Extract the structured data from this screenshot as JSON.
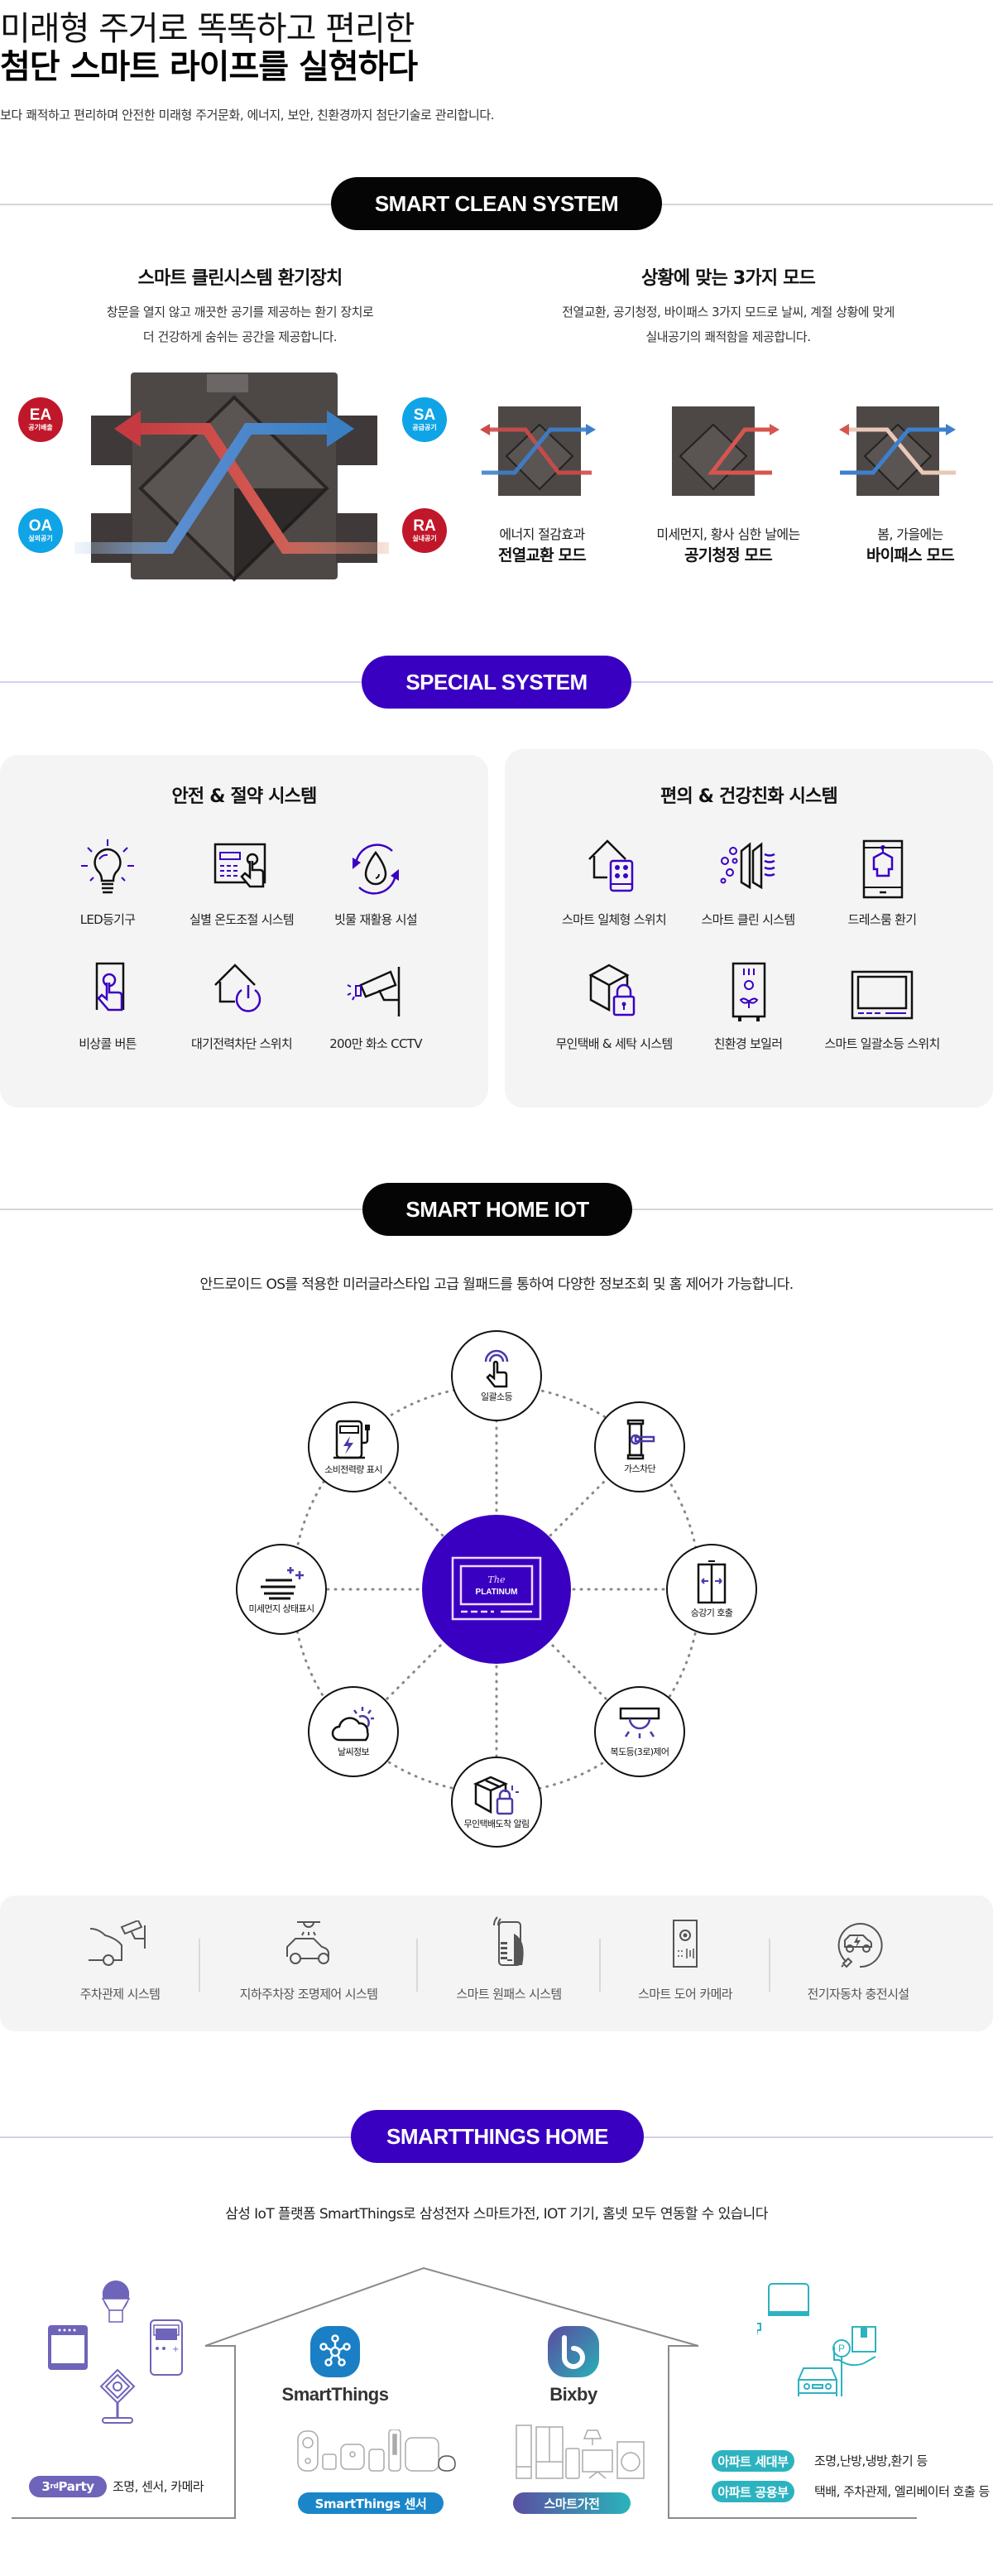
{
  "hero": {
    "line1": "미래형 주거로 똑똑하고 편리한",
    "line2": "첨단 스마트 라이프를 실현하다",
    "description": "보다 쾌적하고 편리하며 안전한 미래형 주거문화, 에너지, 보안, 친환경까지 첨단기술로 관리합니다."
  },
  "colors": {
    "accent_purple": "#3a00c2",
    "black_pill": "#050505",
    "ea_red": "#c0172b",
    "oa_blue": "#0fa4e6",
    "panel_bg": "#f4f4f5",
    "smartthings_blue": "#1a86c9",
    "teal": "#2db3c0",
    "third_party_purple": "#6e64b9"
  },
  "smart_clean": {
    "section_label": "SMART CLEAN SYSTEM",
    "left": {
      "title": "스마트 클린시스템 환기장치",
      "desc_line1": "창문을 열지 않고 깨끗한 공기를 제공하는 환기 장치로",
      "desc_line2": "더 건강하게 숨쉬는 공간을 제공합니다.",
      "badges": [
        {
          "code": "EA",
          "label": "공기배출"
        },
        {
          "code": "SA",
          "label": "공급공기"
        },
        {
          "code": "OA",
          "label": "실외공기"
        },
        {
          "code": "RA",
          "label": "실내공기"
        }
      ]
    },
    "right": {
      "title": "상황에 맞는 3가지 모드",
      "desc_line1": "전열교환, 공기청정, 바이패스 3가지 모드로 날씨, 계절 상황에 맞게",
      "desc_line2": "실내공기의 쾌적함을 제공합니다.",
      "modes": [
        {
          "caption": "에너지 절감효과",
          "name": "전열교환 모드"
        },
        {
          "caption": "미세먼지, 황사 심한 날에는",
          "name": "공기청정 모드"
        },
        {
          "caption": "봄, 가을에는",
          "name": "바이패스 모드"
        }
      ]
    }
  },
  "special": {
    "section_label": "SPECIAL SYSTEM",
    "panels": [
      {
        "title": "안전 & 절약 시스템",
        "items": [
          {
            "label": "LED등기구",
            "icon": "lightbulb-icon"
          },
          {
            "label": "실별 온도조절 시스템",
            "icon": "thermostat-panel-icon"
          },
          {
            "label": "빗물 재활용 시설",
            "icon": "water-recycle-icon"
          },
          {
            "label": "비상콜 버튼",
            "icon": "emergency-call-button-icon"
          },
          {
            "label": "대기전력차단 스위치",
            "icon": "standby-power-switch-icon"
          },
          {
            "label": "200만 화소 CCTV",
            "icon": "cctv-camera-icon"
          }
        ]
      },
      {
        "title": "편의 & 건강친화 시스템",
        "items": [
          {
            "label": "스마트 일체형 스위치",
            "icon": "smart-switch-icon"
          },
          {
            "label": "스마트 클린 시스템",
            "icon": "air-filter-icon"
          },
          {
            "label": "드레스룸 환기",
            "icon": "dressroom-vent-icon"
          },
          {
            "label": "무인택배 & 세탁 시스템",
            "icon": "parcel-locker-icon"
          },
          {
            "label": "친환경 보일러",
            "icon": "eco-boiler-icon"
          },
          {
            "label": "스마트 일괄소등 스위치",
            "icon": "master-light-switch-icon"
          }
        ]
      }
    ]
  },
  "iot": {
    "section_label": "SMART HOME IOT",
    "description": "안드로이드 OS를 적용한 미러글라스타입 고급 월패드를 통하여 다양한 정보조회 및 홈 제어가 가능합니다.",
    "hub": {
      "script": "The",
      "brand": "PLATINUM"
    },
    "nodes": [
      {
        "label": "일괄소등",
        "icon": "touch-icon"
      },
      {
        "label": "가스차단",
        "icon": "gas-valve-icon"
      },
      {
        "label": "승강기 호출",
        "icon": "elevator-icon"
      },
      {
        "label": "복도등(3로)제어",
        "icon": "ceiling-light-icon"
      },
      {
        "label": "무인택배도착 알림",
        "icon": "parcel-lock-icon"
      },
      {
        "label": "날씨정보",
        "icon": "weather-icon"
      },
      {
        "label": "미세먼지 상태표시",
        "icon": "fine-dust-icon"
      },
      {
        "label": "소비전력량 표시",
        "icon": "power-meter-icon"
      }
    ],
    "strip": [
      {
        "label": "주차관제 시스템",
        "icon": "parking-cctv-icon"
      },
      {
        "label": "지하주차장 조명제어 시스템",
        "icon": "parking-light-icon"
      },
      {
        "label": "스마트 원패스 시스템",
        "icon": "one-pass-phone-icon"
      },
      {
        "label": "스마트 도어 카메라",
        "icon": "door-camera-icon"
      },
      {
        "label": "전기자동차 충전시설",
        "icon": "ev-charger-icon"
      }
    ]
  },
  "smartthings": {
    "section_label": "SMARTTHINGS HOME",
    "description": "삼성 IoT 플랫폼 SmartThings로 삼성전자 스마트가전, IOT 기기, 홈넷 모두 연동할 수 있습니다",
    "third_party": {
      "tag_main": "3",
      "tag_sup": "rd",
      "tag_rest": "Party",
      "text": "조명, 센서, 카메라"
    },
    "smartthings_brand": "SmartThings",
    "smartthings_tag": "SmartThings 센서",
    "bixby_brand": "Bixby",
    "bixby_tag": "스마트가전",
    "apartment": [
      {
        "tag": "아파트 세대부",
        "text": "조명,난방,냉방,환기 등"
      },
      {
        "tag": "아파트 공용부",
        "text": "택배, 주차관제, 엘리베이터 호출 등"
      }
    ]
  }
}
